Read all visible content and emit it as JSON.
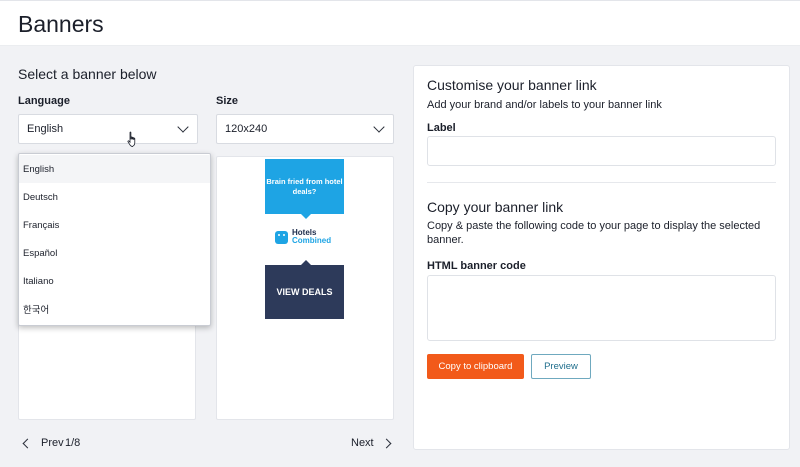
{
  "header": {
    "title": "Banners"
  },
  "selector": {
    "title": "Select a banner below",
    "language_label": "Language",
    "language_value": "English",
    "size_label": "Size",
    "size_value": "120x240",
    "language_options": [
      "English",
      "Deutsch",
      "Français",
      "Español",
      "Italiano",
      "한국어"
    ]
  },
  "banner": {
    "cta_text": "Brain fried from hotel deals?",
    "logo_line1": "Hotels",
    "logo_line2": "Combined",
    "deals_text": "VIEW DEALS",
    "colors": {
      "cta": "#1ea4e4",
      "deals": "#2d3a5a"
    }
  },
  "pagination": {
    "prev_label": "Prev",
    "page_indicator": "1/8",
    "next_label": "Next"
  },
  "customise": {
    "title": "Customise your banner link",
    "description": "Add your brand and/or labels to your banner link",
    "label_field_label": "Label",
    "label_value": ""
  },
  "copy": {
    "title": "Copy your banner link",
    "description": "Copy & paste the following code to your page to display the selected banner.",
    "code_field_label": "HTML banner code",
    "code_value": "",
    "copy_button": "Copy to clipboard",
    "preview_button": "Preview"
  },
  "colors": {
    "accent": "#f25a1a",
    "secondary": "#1f6e8c"
  }
}
